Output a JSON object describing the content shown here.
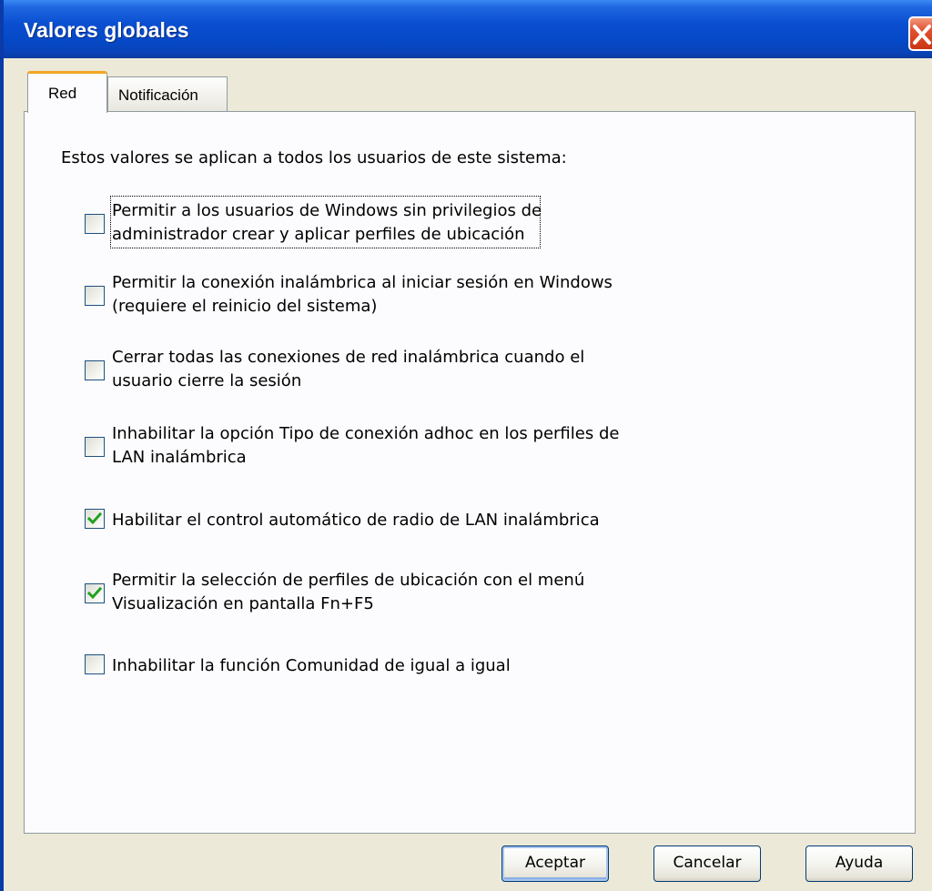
{
  "window": {
    "title": "Valores globales"
  },
  "tabs": [
    {
      "label": "Red",
      "active": true
    },
    {
      "label": "Notificación",
      "active": false
    }
  ],
  "panel": {
    "intro": "Estos valores se aplican a todos los usuarios de este sistema:",
    "options": [
      {
        "line1": "Permitir a los usuarios de Windows sin privilegios de",
        "line2": "administrador crear y aplicar perfiles de ubicación",
        "checked": false
      },
      {
        "line1": "Permitir la conexión inalámbrica al iniciar sesión en Windows",
        "line2": "(requiere el reinicio del sistema)",
        "checked": false
      },
      {
        "line1": "Cerrar todas las conexiones de red inalámbrica cuando el",
        "line2": "usuario cierre la sesión",
        "checked": false
      },
      {
        "line1": "Inhabilitar la opción Tipo de conexión adhoc en los perfiles de",
        "line2": "LAN inalámbrica",
        "checked": false
      },
      {
        "line1": "Habilitar el control automático de radio de LAN inalámbrica",
        "checked": true
      },
      {
        "line1": "Permitir la selección de perfiles de ubicación con el menú",
        "line2": "Visualización en pantalla Fn+F5",
        "checked": true
      },
      {
        "line1": "Inhabilitar la función Comunidad de igual a igual",
        "checked": false
      }
    ]
  },
  "buttons": {
    "ok": "Aceptar",
    "cancel": "Cancelar",
    "help": "Ayuda"
  },
  "icons": {
    "close": "close-icon",
    "check": "checkmark-icon"
  },
  "colors": {
    "titlebar": "#0549c7",
    "active_tab_accent": "#f4a623",
    "check": "#21a121",
    "close": "#e0502f"
  }
}
